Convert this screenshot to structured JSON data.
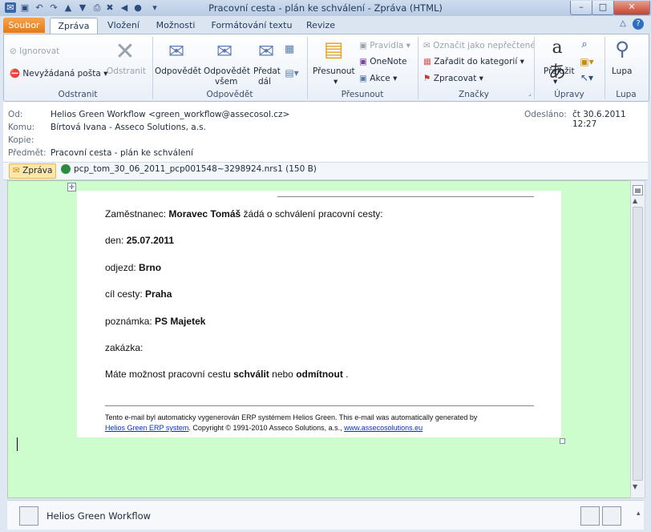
{
  "window": {
    "title": "Pracovní cesta - plán ke schválení  -  Zpráva (HTML)",
    "controls": {
      "min": "–",
      "max": "□",
      "close": "✕"
    }
  },
  "tabs": {
    "file": "Soubor",
    "items": [
      "Zpráva",
      "Vložení",
      "Možnosti",
      "Formátování textu",
      "Revize"
    ]
  },
  "ribbon": {
    "odstranit": {
      "label": "Odstranit",
      "ignore": "Ignorovat",
      "junk": "Nevyžádaná pošta",
      "delete": "Odstranit"
    },
    "odpovedet": {
      "label": "Odpovědět",
      "reply": "Odpovědět",
      "reply_all_1": "Odpovědět",
      "reply_all_2": "všem",
      "forward_1": "Předat",
      "forward_2": "dál"
    },
    "presunout": {
      "label": "Přesunout",
      "move": "Přesunout",
      "rules": "Pravidla",
      "onenote": "OneNote",
      "actions": "Akce"
    },
    "znacky": {
      "label": "Značky",
      "unread": "Označit jako nepřečtené",
      "categorize": "Zařadit do kategorií",
      "followup": "Zpracovat"
    },
    "upravy": {
      "label": "Úpravy",
      "translate": "Přeložit"
    },
    "lupa": {
      "label": "Lupa",
      "zoom": "Lupa"
    }
  },
  "header": {
    "from_label": "Od:",
    "from": "Helios Green Workflow <green_workflow@assecosol.cz>",
    "to_label": "Komu:",
    "to": "Bírtová Ivana - Asseco Solutions, a.s.",
    "cc_label": "Kopie:",
    "cc": "",
    "subject_label": "Předmět:",
    "subject": "Pracovní cesta - plán ke schválení",
    "sent_label": "Odesláno:",
    "sent": "čt 30.6.2011 12:27"
  },
  "attachments": {
    "message_tab": "Zpráva",
    "file": "pcp_tom_30_06_2011_pcp001548~3298924.nrs1 (150 B)"
  },
  "body": {
    "employee_prefix": "Zaměstnanec:",
    "employee": "Moravec Tomáš",
    "employee_suffix": "žádá o schválení pracovní cesty:",
    "date_label": "den:",
    "date": "25.07.2011",
    "departure_label": "odjezd:",
    "departure": "Brno",
    "destination_label": "cíl cesty:",
    "destination": "Praha",
    "note_label": "poznámka:",
    "note": "PS Majetek",
    "order_label": "zakázka:",
    "action_prefix": "Máte možnost pracovní cestu",
    "approve": "schválit",
    "action_mid": "nebo",
    "reject": "odmítnout",
    "action_suffix": ".",
    "footer_line1": "Tento e-mail byl automaticky vygenerován ERP systémem Helios Green. This e-mail was automatically generated by",
    "footer_link1": "Helios Green ERP system",
    "footer_mid": ". Copyright © 1991-2010 Asseco Solutions, a.s.,",
    "footer_link2": "www.assecosolutions.eu"
  },
  "people_pane": {
    "name": "Helios Green Workflow"
  },
  "colors": {
    "file_tab": "#e57a16",
    "message_bg": "#cdfccd",
    "link": "#0033cc"
  }
}
